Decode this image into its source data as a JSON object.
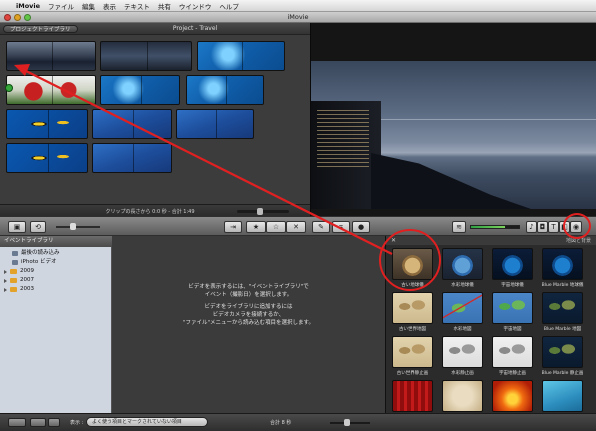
{
  "menubar": {
    "apple_icon": "apple-icon",
    "app_name": "iMovie",
    "items": [
      "ファイル",
      "編集",
      "表示",
      "テキスト",
      "共有",
      "ウインドウ",
      "ヘルプ"
    ]
  },
  "window": {
    "title": "iMovie"
  },
  "project": {
    "library_button": "プロジェクトライブラリ",
    "title": "Project - Travel",
    "status": "クリップの長さから 0:0 秒 - 合計 1:49"
  },
  "toolbar": {
    "icons": [
      "camera-icon",
      "rotate-icon",
      "thumbnail-slider",
      "import-icon",
      "favorite-star-icon",
      "unmark-star-icon",
      "reject-x-icon",
      "crop-pen-icon",
      "crop-icon",
      "voiceover-mic-icon",
      "audio-meter",
      "music-icon",
      "photo-icon",
      "title-icon",
      "transition-icon",
      "maps-backgrounds-icon"
    ]
  },
  "event_library": {
    "header": "イベントライブラリ",
    "items": [
      {
        "label": "最後の読み込み",
        "indent": 1
      },
      {
        "label": "iPhoto ビデオ",
        "indent": 1
      },
      {
        "label": "2009",
        "indent": 0
      },
      {
        "label": "2007",
        "indent": 0
      },
      {
        "label": "2003",
        "indent": 0
      }
    ]
  },
  "event_browser": {
    "message_lines": [
      "ビデオを表示するには、\"イベントライブラリ\"で",
      "イベント（撮影日）を選択します。",
      "",
      "ビデオをライブラリに追加するには",
      "ビデオカメラを接続するか、",
      "\"ファイル\"メニューから読み込む項目を選択します。"
    ]
  },
  "maps_panel": {
    "title": "地図と背景",
    "tiles": [
      {
        "caption": "古い地球儀",
        "style": "t-globe-old"
      },
      {
        "caption": "水彩地球儀",
        "style": "t-globe"
      },
      {
        "caption": "宇宙地球儀",
        "style": "t-globe-blue"
      },
      {
        "caption": "Blue Marble 地球儀",
        "style": "t-globe-blue"
      },
      {
        "caption": "古い世界地図",
        "style": "t-map-old"
      },
      {
        "caption": "水彩地図",
        "style": "t-map-route"
      },
      {
        "caption": "宇宙地図",
        "style": "t-map"
      },
      {
        "caption": "Blue Marble 地図",
        "style": "t-map-dark"
      },
      {
        "caption": "古い世界静止画",
        "style": "t-map-old"
      },
      {
        "caption": "水彩静止画",
        "style": "t-map-white"
      },
      {
        "caption": "宇宙地静止画",
        "style": "t-map-white"
      },
      {
        "caption": "Blue Marble 静止画",
        "style": "t-map-dark"
      },
      {
        "caption": "カーテン",
        "style": "t-curtain"
      },
      {
        "caption": "オーガニック",
        "style": "t-paper"
      },
      {
        "caption": "にじみ",
        "style": "t-fire"
      },
      {
        "caption": "氷河",
        "style": "t-ice"
      }
    ]
  },
  "bottombar": {
    "label": "表示 :",
    "popup": "よく使う項目とマークされていない項目",
    "total": "合計 8 秒"
  },
  "annotation": {
    "color": "#e02020"
  }
}
